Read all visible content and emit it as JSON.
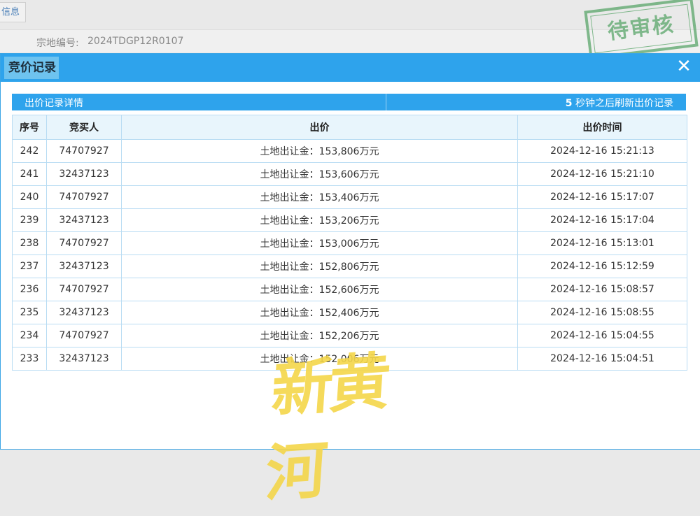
{
  "background": {
    "tab_label": "信息",
    "field_label": "宗地编号:",
    "field_value": "2024TDGP12R0107",
    "stamp_text": "待审核"
  },
  "modal": {
    "title": "竞价记录",
    "close_icon": "close-icon",
    "subbar": {
      "title": "出价记录详情",
      "refresh_seconds": "5",
      "refresh_text": " 秒钟之后刷新出价记录"
    },
    "table": {
      "headers": [
        "序号",
        "竞买人",
        "出价",
        "出价时间"
      ],
      "rows": [
        {
          "no": "242",
          "bidder": "74707927",
          "price": "土地出让金：153,806万元",
          "time": "2024-12-16 15:21:13"
        },
        {
          "no": "241",
          "bidder": "32437123",
          "price": "土地出让金：153,606万元",
          "time": "2024-12-16 15:21:10"
        },
        {
          "no": "240",
          "bidder": "74707927",
          "price": "土地出让金：153,406万元",
          "time": "2024-12-16 15:17:07"
        },
        {
          "no": "239",
          "bidder": "32437123",
          "price": "土地出让金：153,206万元",
          "time": "2024-12-16 15:17:04"
        },
        {
          "no": "238",
          "bidder": "74707927",
          "price": "土地出让金：153,006万元",
          "time": "2024-12-16 15:13:01"
        },
        {
          "no": "237",
          "bidder": "32437123",
          "price": "土地出让金：152,806万元",
          "time": "2024-12-16 15:12:59"
        },
        {
          "no": "236",
          "bidder": "74707927",
          "price": "土地出让金：152,606万元",
          "time": "2024-12-16 15:08:57"
        },
        {
          "no": "235",
          "bidder": "32437123",
          "price": "土地出让金：152,406万元",
          "time": "2024-12-16 15:08:55"
        },
        {
          "no": "234",
          "bidder": "74707927",
          "price": "土地出让金：152,206万元",
          "time": "2024-12-16 15:04:55"
        },
        {
          "no": "233",
          "bidder": "32437123",
          "price": "土地出让金：152,006万元",
          "time": "2024-12-16 15:04:51"
        }
      ]
    }
  },
  "watermark_text": "新黄河",
  "colors": {
    "header_blue": "#2ea3ec",
    "title_tab": "#6ec3ef",
    "table_border": "#b9dcf3",
    "stamp_green": "#5aa66a",
    "watermark_yellow": "#f4d64a"
  }
}
